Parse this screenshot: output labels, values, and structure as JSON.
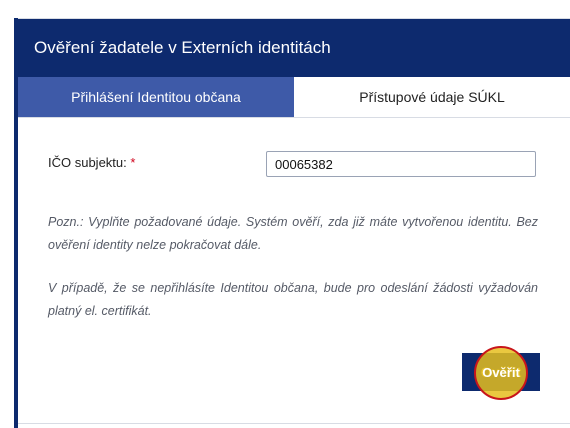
{
  "panel": {
    "title": "Ověření žadatele v Externích identitách"
  },
  "tabs": [
    {
      "label": "Přihlášení Identitou občana",
      "active": true
    },
    {
      "label": "Přístupové údaje SÚKL",
      "active": false
    }
  ],
  "form": {
    "ico_label": "IČO subjektu:",
    "required_marker": "*",
    "ico_value": "00065382"
  },
  "notes": {
    "note_1": "Pozn.: Vyplňte požadované údaje. Systém ověří, zda již máte vytvořenou identitu. Bez ověření identity nelze pokračovat dále.",
    "note_2": "V případě, že se nepřihlásíte Identitou občana, bude pro odeslání žádosti vyžadován platný el. certifikát."
  },
  "actions": {
    "verify_label": "Ověřit"
  },
  "colors": {
    "header_bg": "#0d2a6e",
    "active_tab_bg": "#3e5aa8",
    "required": "#d0021b",
    "button_text": "#f7e04a",
    "click_highlight": "#e6be1e"
  },
  "icons": {
    "click_marker": "click-highlight-circle"
  }
}
